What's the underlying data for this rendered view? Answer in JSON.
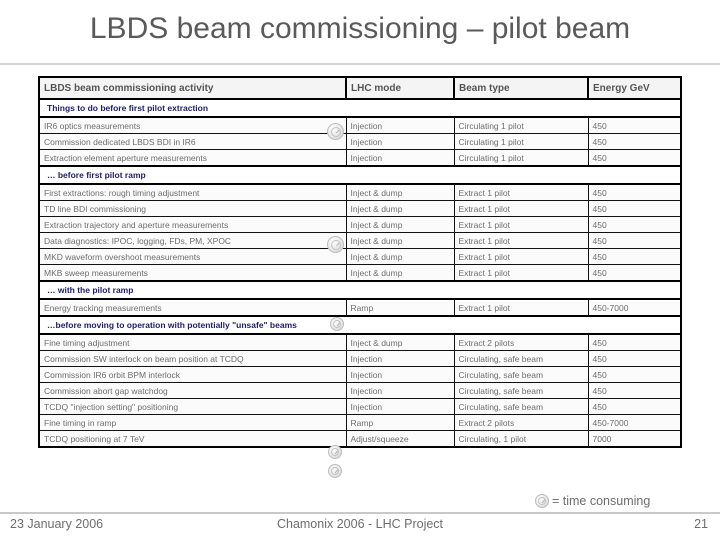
{
  "slide": {
    "title": "LBDS beam commissioning – pilot beam"
  },
  "table": {
    "headers": {
      "activity": "LBDS beam commissioning activity",
      "mode": "LHC mode",
      "beam": "Beam type",
      "energy": "Energy GeV"
    },
    "sections": [
      {
        "heading": "Things to do before first pilot extraction",
        "rows": [
          {
            "activity": "IR6 optics measurements",
            "mode": "Injection",
            "beam": "Circulating 1 pilot",
            "energy": "450",
            "clock": true
          },
          {
            "activity": "Commission dedicated LBDS BDI in IR6",
            "mode": "Injection",
            "beam": "Circulating 1 pilot",
            "energy": "450",
            "clock": false
          },
          {
            "activity": "Extraction element aperture measurements",
            "mode": "Injection",
            "beam": "Circulating 1 pilot",
            "energy": "450",
            "clock": false
          }
        ]
      },
      {
        "heading": "… before first pilot ramp",
        "rows": [
          {
            "activity": "First extractions: rough timing adjustment",
            "mode": "Inject & dump",
            "beam": "Extract 1 pilot",
            "energy": "450",
            "clock": false
          },
          {
            "activity": "TD line BDI commissioning",
            "mode": "Inject & dump",
            "beam": "Extract 1 pilot",
            "energy": "450",
            "clock": false
          },
          {
            "activity": "Extraction trajectory and aperture measurements",
            "mode": "Inject & dump",
            "beam": "Extract 1 pilot",
            "energy": "450",
            "clock": false
          },
          {
            "activity": "Data diagnostics: IPOC, logging, FDs, PM, XPOC",
            "mode": "Inject & dump",
            "beam": "Extract 1 pilot",
            "energy": "450",
            "clock": true
          },
          {
            "activity": "MKD waveform overshoot measurements",
            "mode": "Inject & dump",
            "beam": "Extract 1 pilot",
            "energy": "450",
            "clock": false
          },
          {
            "activity": "MKB sweep measurements",
            "mode": "Inject & dump",
            "beam": "Extract 1 pilot",
            "energy": "450",
            "clock": false
          }
        ]
      },
      {
        "heading": "… with the pilot ramp",
        "rows": [
          {
            "activity": "Energy tracking measurements",
            "mode": "Ramp",
            "beam": "Extract 1 pilot",
            "energy": "450-7000",
            "clock": false
          }
        ]
      },
      {
        "heading": "…before moving to operation with potentially \"unsafe\" beams",
        "rows": [
          {
            "activity": "Fine timing adjustment",
            "mode": "Inject & dump",
            "beam": "Extract 2 pilots",
            "energy": "450",
            "clock": false
          },
          {
            "activity": "Commission SW interlock on beam position at TCDQ",
            "mode": "Injection",
            "beam": "Circulating, safe beam",
            "energy": "450",
            "clock": false
          },
          {
            "activity": "Commission IR6 orbit BPM interlock",
            "mode": "Injection",
            "beam": "Circulating, safe beam",
            "energy": "450",
            "clock": false
          },
          {
            "activity": "Commission abort gap watchdog",
            "mode": "Injection",
            "beam": "Circulating, safe beam",
            "energy": "450",
            "clock": false
          },
          {
            "activity": "TCDQ \"injection setting\" positioning",
            "mode": "Injection",
            "beam": "Circulating, safe beam",
            "energy": "450",
            "clock": false
          },
          {
            "activity": "Fine timing in ramp",
            "mode": "Ramp",
            "beam": "Extract 2 pilots",
            "energy": "450-7000",
            "clock": false
          },
          {
            "activity": "TCDQ positioning at 7 TeV",
            "mode": "Adjust/squeeze",
            "beam": "Circulating, 1 pilot",
            "energy": "7000",
            "clock": false
          }
        ]
      }
    ]
  },
  "legend": {
    "icon": "clock-icon",
    "text": "= time consuming"
  },
  "footer": {
    "date": "23 January 2006",
    "center": "Chamonix 2006 - LHC Project",
    "page": "21"
  },
  "colors": {
    "title_text": "#5a5a5a",
    "section_heading": "#1b1b6f",
    "cell_text": "#6e6e6e",
    "border": "#000000"
  }
}
